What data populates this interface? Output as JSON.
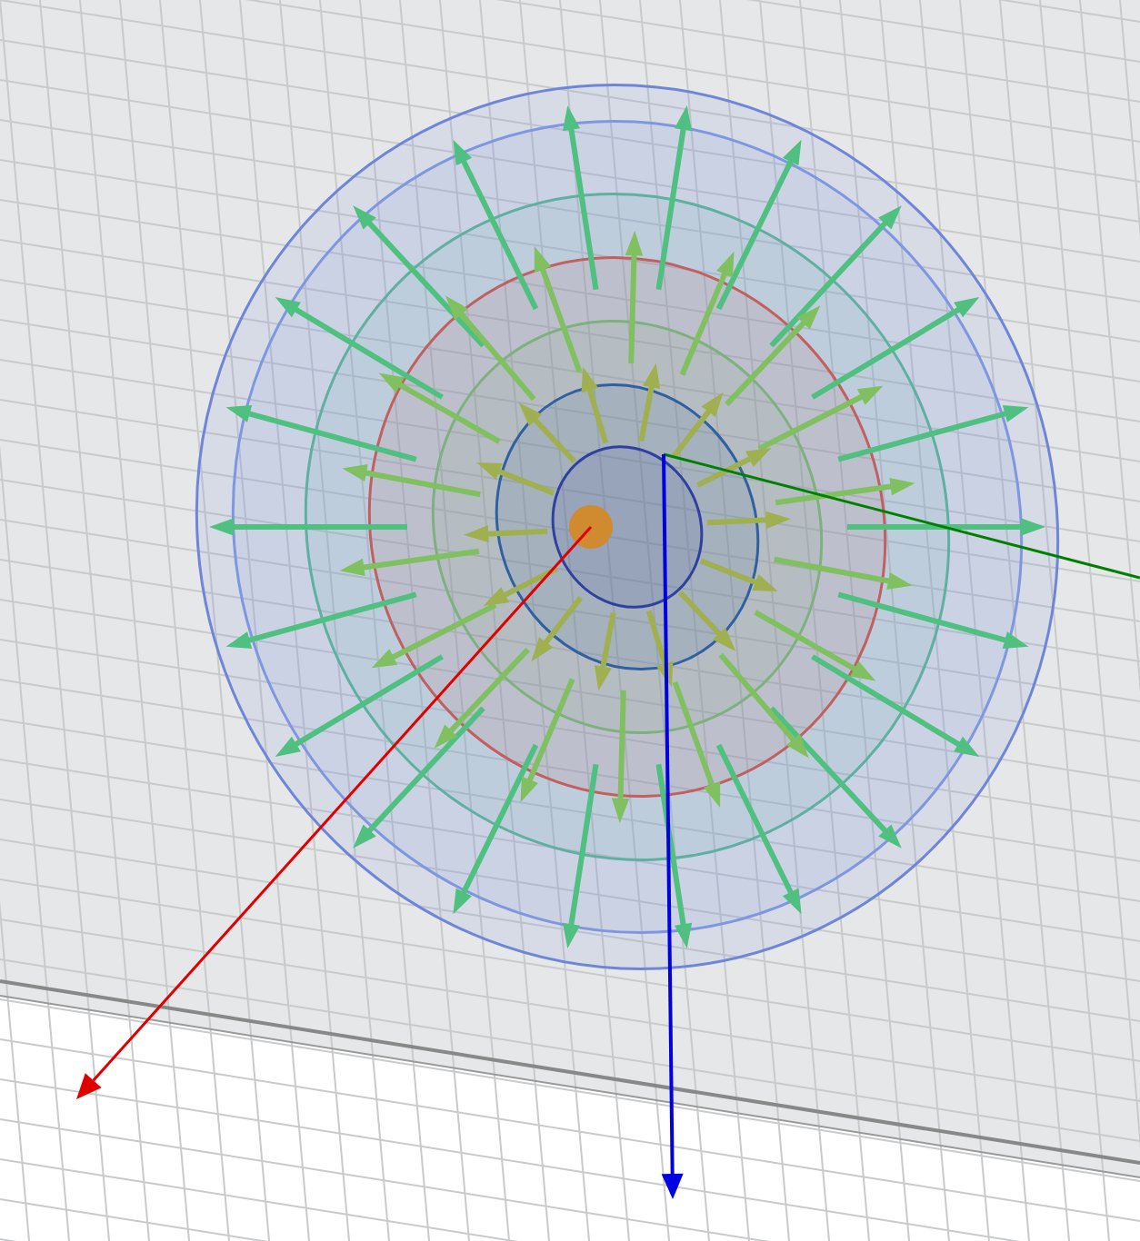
{
  "viewport": {
    "axes": [
      {
        "color": "#e00000"
      },
      {
        "color": "#008000"
      },
      {
        "color": "#0000e0"
      }
    ]
  }
}
